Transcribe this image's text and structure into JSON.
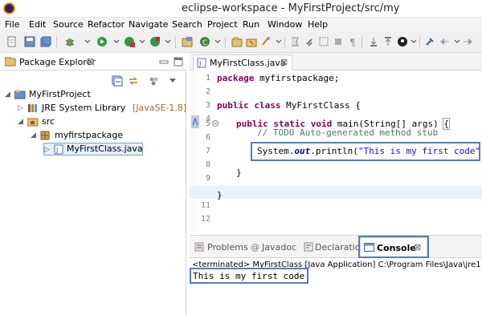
{
  "window": {
    "title": "eclipse-workspace - MyFirstProject/src/my"
  },
  "menu": [
    "File",
    "Edit",
    "Source",
    "Refactor",
    "Navigate",
    "Search",
    "Project",
    "Run",
    "Window",
    "Help"
  ],
  "package_explorer": {
    "tab_label": "Package Explorer",
    "close_glyph": "⊠",
    "tree": {
      "project": "MyFirstProject",
      "jre_label": "JRE System Library",
      "jre_version": "[JavaSE-1.8]",
      "src": "src",
      "package": "myfirstpackage",
      "file": "MyFirstClass.java"
    }
  },
  "editor": {
    "tab_label": "MyFirstClass.java",
    "close_glyph": "⊠",
    "line_numbers": [
      "1",
      "2",
      "3",
      "4",
      "5",
      "6",
      "7",
      "8",
      "9",
      "10",
      "11",
      "12"
    ],
    "code": {
      "l1_kw": "package",
      "l1_rest": " myfirstpackage;",
      "l3_kw1": "public",
      "l3_kw2": "class",
      "l3_rest": " MyFirstClass {",
      "l5_kw1": "public",
      "l5_kw2": "static",
      "l5_kw3": "void",
      "l5_rest": " main(String[] args) ",
      "l5_brace": "{",
      "l6_comment": "// TODO Auto-generated method stub",
      "l8_pre": "System.",
      "l8_field": "out",
      "l8_mid": ".println(",
      "l8_str": "\"This is my first code\"",
      "l8_end": ");",
      "l10": "}",
      "l12": "}"
    }
  },
  "bottom_panel": {
    "tabs": {
      "problems": "Problems",
      "javadoc": "Javadoc",
      "declaration": "Declaration",
      "console": "Console"
    },
    "console_close_glyph": "⊠",
    "terminated_line": "<terminated> MyFirstClass [Java Application] C:\\Program Files\\Java\\jre1.8.0_1",
    "output": "This is my first code"
  },
  "colors": {
    "keyword": "#7f0055",
    "comment": "#3f7f5f",
    "string": "#2a00ff",
    "field": "#0000c0",
    "highlight_box": "#5b7cae"
  }
}
